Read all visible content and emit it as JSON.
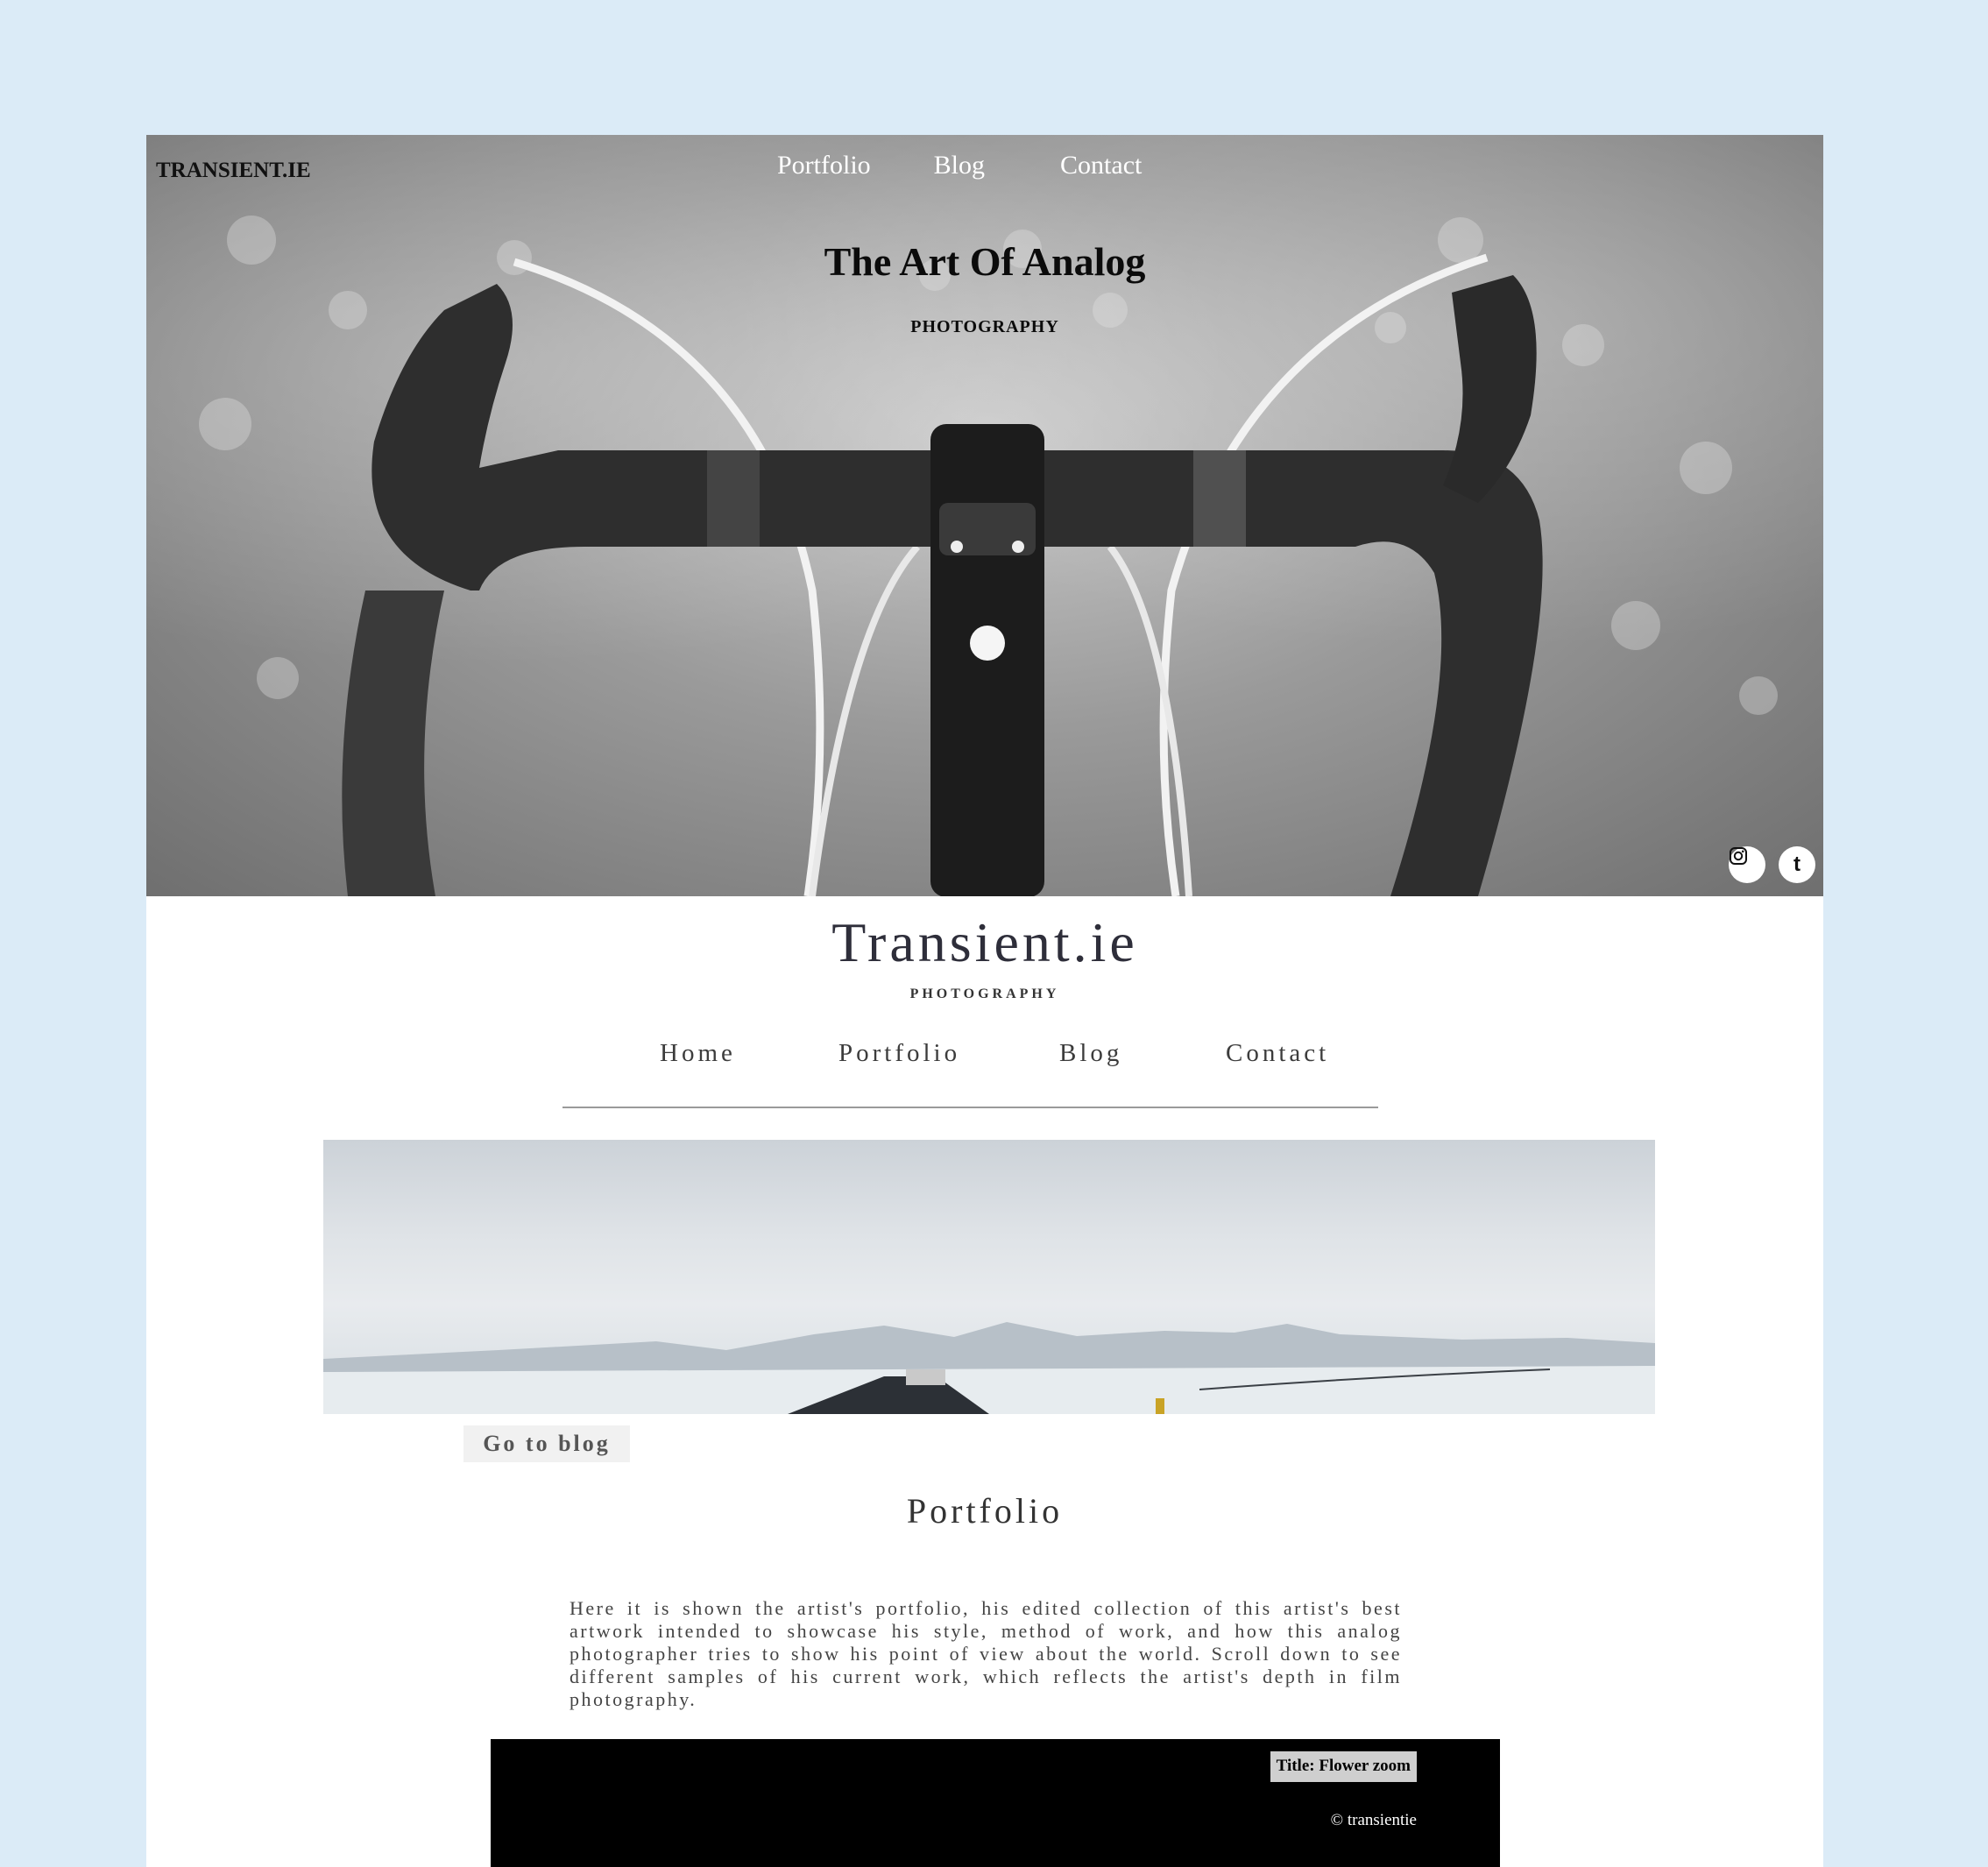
{
  "hero": {
    "brand": "TRANSIENT.IE",
    "nav": [
      "Portfolio",
      "Blog",
      "Contact"
    ],
    "title": "The Art Of Analog",
    "subtitle": "PHOTOGRAPHY",
    "social": {
      "instagram_icon": "instagram-icon",
      "tumblr_icon": "tumblr-icon",
      "tumblr_glyph": "t"
    }
  },
  "site": {
    "title": "Transient.ie",
    "subtitle": "PHOTOGRAPHY",
    "nav": [
      "Home",
      "Portfolio",
      "Blog",
      "Contact"
    ]
  },
  "blog_button": "Go to blog",
  "portfolio": {
    "heading": "Portfolio",
    "description": "Here it is shown the artist's portfolio, his edited collection of this artist's best artwork intended to showcase his style, method of work, and how this analog photographer tries to show his point of view about the world. Scroll down to see different samples of his current work, which reflects the artist's depth in film photography."
  },
  "gallery": {
    "caption": "Title: Flower zoom",
    "copyright": "© transientie"
  },
  "colors": {
    "page_bg": "#dbebf7",
    "content_bg": "#ffffff",
    "gallery_bg": "#000000"
  }
}
